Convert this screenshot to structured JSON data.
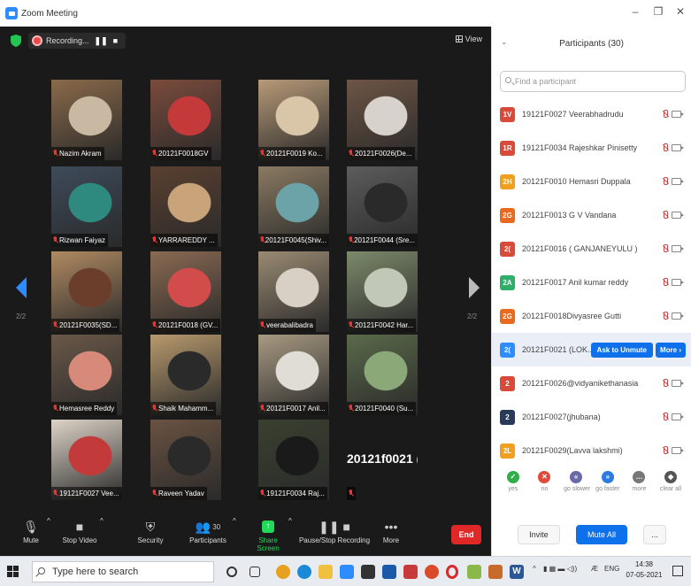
{
  "window": {
    "title": "Zoom Meeting",
    "controls": [
      "–",
      "❐",
      "✕"
    ]
  },
  "meeting": {
    "recording_label": "Recording...",
    "view_label": "View",
    "page_left": "2/2",
    "page_right": "2/2",
    "tiles": [
      {
        "name": "Nazim Akram",
        "bg": "#8a6a4a",
        "fg": "#c9b8a2"
      },
      {
        "name": "20121F0018GV",
        "bg": "#7b4b3c",
        "fg": "#c43a3a"
      },
      {
        "name": "20121F0019 Ko...",
        "bg": "#b79a78",
        "fg": "#d9c6a8"
      },
      {
        "name": "20121F0026(De...",
        "bg": "#6e5545",
        "fg": "#d8d2cc"
      },
      {
        "name": "Rizwan Faiyaz",
        "bg": "#3e4a5a",
        "fg": "#2e8a7e"
      },
      {
        "name": "YARRAREDDY ...",
        "bg": "#5a4030",
        "fg": "#c9a47a"
      },
      {
        "name": "20121F0045(Shiv...",
        "bg": "#8a7a62",
        "fg": "#6ba3a8"
      },
      {
        "name": "20121F0044 (Sre...",
        "bg": "#5c5c5c",
        "fg": "#2a2a2a"
      },
      {
        "name": "20121F0035(SD...",
        "bg": "#b08a62",
        "fg": "#6a3e2a"
      },
      {
        "name": "20121F0018 (GV...",
        "bg": "#8a6a52",
        "fg": "#d24c4c"
      },
      {
        "name": "veerabalibadra",
        "bg": "#9a8a72",
        "fg": "#d8d0c4"
      },
      {
        "name": "20121F0042 Har...",
        "bg": "#7c8a6a",
        "fg": "#c2c8b8"
      },
      {
        "name": "Hemasree Reddy",
        "bg": "#6a5848",
        "fg": "#d88a7a"
      },
      {
        "name": "Shaik Mahamm...",
        "bg": "#b89a6e",
        "fg": "#2a2a2a"
      },
      {
        "name": "20121F0017 Anil...",
        "bg": "#a89a82",
        "fg": "#e0dcd6"
      },
      {
        "name": "20121F0040 (Su...",
        "bg": "#5a6a4a",
        "fg": "#8aa878"
      },
      {
        "name": "19121F0027 Vee...",
        "bg": "#ddd4c8",
        "fg": "#c23a3a"
      },
      {
        "name": "Raveen Yadav",
        "bg": "#6a5242",
        "fg": "#2a2a2a"
      },
      {
        "name": "19121F0034 Raj...",
        "bg": "#3a4030",
        "fg": "#1a1a1a"
      },
      {
        "name": "20121f0021 (LO...",
        "bg": "#1a1a1a",
        "fg": "#1a1a1a",
        "text_only": true
      }
    ]
  },
  "toolbar": {
    "mute": "Mute",
    "video": "Stop Video",
    "security": "Security",
    "participants": "Participants",
    "participants_count": "30",
    "share": "Share Screen",
    "record": "Pause/Stop Recording",
    "more": "More",
    "end": "End"
  },
  "panel": {
    "title": "Participants (30)",
    "search_placeholder": "Find a participant",
    "participants": [
      {
        "initials": "1V",
        "name": "19121F0027 Veerabhadrudu",
        "color": "#d84a3a"
      },
      {
        "initials": "1R",
        "name": "19121F0034 Rajeshkar Pinisetty",
        "color": "#d84a3a"
      },
      {
        "initials": "2H",
        "name": "20121F0010 Hemasri Duppala",
        "color": "#f0a020"
      },
      {
        "initials": "2G",
        "name": "20121F0013 G V Vandana",
        "color": "#e86a20"
      },
      {
        "initials": "2(",
        "name": "20121F0016 ( GANJANEYULU )",
        "color": "#d84a3a"
      },
      {
        "initials": "2A",
        "name": "20121F0017 Anil kumar reddy",
        "color": "#2fae6a"
      },
      {
        "initials": "2G",
        "name": "20121F0018Divyasree Gutti",
        "color": "#e86a20"
      },
      {
        "initials": "2(",
        "name": "20121F0021 (LOK...",
        "color": "#2d8cff",
        "highlight": true
      },
      {
        "initials": "2",
        "name": "20121F0026@vidyanikethanasia",
        "color": "#d84a3a"
      },
      {
        "initials": "2",
        "name": "20121F0027(jhubana)",
        "color": "#2a3a5a"
      },
      {
        "initials": "2L",
        "name": "20121F0029(Lavva lakshmi)",
        "color": "#f0a020"
      }
    ],
    "ask_unmute": "Ask to Unmute",
    "more": "More ›",
    "reactions": [
      {
        "label": "yes",
        "color": "#2fae4a",
        "glyph": "✓"
      },
      {
        "label": "no",
        "color": "#e04a3a",
        "glyph": "✕"
      },
      {
        "label": "go slower",
        "color": "#6a6aa8",
        "glyph": "«"
      },
      {
        "label": "go faster",
        "color": "#2d7ae0",
        "glyph": "»"
      },
      {
        "label": "more",
        "color": "#777",
        "glyph": "…"
      },
      {
        "label": "clear all",
        "color": "#555",
        "glyph": "◆"
      }
    ],
    "invite": "Invite",
    "mute_all": "Mute All",
    "more_dots": "..."
  },
  "taskbar": {
    "search_placeholder": "Type here to search",
    "lang": "ENG",
    "time": "14:38",
    "date": "07-05-2021"
  }
}
